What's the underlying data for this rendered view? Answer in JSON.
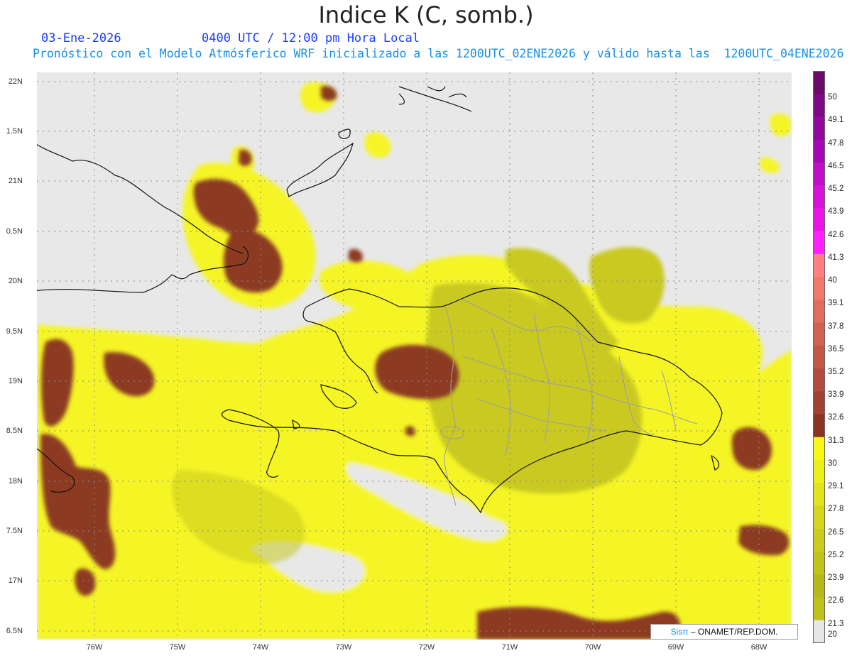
{
  "header": {
    "title": "Indice K (C, somb.)",
    "date": "03-Ene-2026",
    "time": "0400 UTC / 12:00 pm Hora Local",
    "description": "Pronóstico con el Modelo Atmósferico WRF inicializado a las 1200UTC_02ENE2026 y válido hasta las  1200UTC_04ENE2026"
  },
  "axes": {
    "lat_labels": [
      "22N",
      "1.5N",
      "21N",
      "0.5N",
      "20N",
      "9.5N",
      "19N",
      "8.5N",
      "18N",
      "7.5N",
      "17N",
      "6.5N"
    ],
    "lon_labels": [
      "76W",
      "75W",
      "74W",
      "73W",
      "72W",
      "71W",
      "70W",
      "69W",
      "68W"
    ]
  },
  "colorbar": {
    "labels": [
      "50",
      "49.1",
      "47.8",
      "46.5",
      "45.2",
      "43.9",
      "42.6",
      "41.3",
      "40",
      "39.1",
      "37.8",
      "36.5",
      "35.2",
      "33.9",
      "32.6",
      "31.3",
      "30",
      "29.1",
      "27.8",
      "26.5",
      "25.2",
      "23.9",
      "22.6",
      "21.3",
      "20"
    ],
    "colors": [
      "#6a0a6a",
      "#7d0a84",
      "#8f0a9c",
      "#a30ab2",
      "#bf10c8",
      "#d614d8",
      "#ea16e6",
      "#ff22ff",
      "#ff8080",
      "#ee7a6e",
      "#de6e60",
      "#d06254",
      "#c25848",
      "#b24c3e",
      "#a24234",
      "#8c3424",
      "#f8f818",
      "#eeee1c",
      "#e2e21e",
      "#d6d61e",
      "#cccc1e",
      "#c2c21e",
      "#b8b81c",
      "#c0c21a",
      "#e6e6e6"
    ]
  },
  "credit": {
    "brand": "Sisπ",
    "text": "– ONAMET/REP.DOM."
  },
  "colors": {
    "land_sea_bg": "#e8e8e8",
    "yellow": "#f5f527",
    "olive": "#c9c923",
    "brown": "#8c3a22",
    "border_gray": "#a0a0a0"
  }
}
